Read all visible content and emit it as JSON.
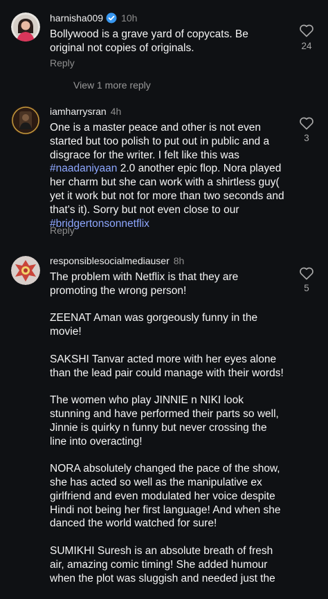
{
  "comments": [
    {
      "username": "harnisha009",
      "time": "10h",
      "verified": true,
      "text": "Bollywood is a grave yard of copycats. Be original not copies of originals.",
      "reply_label": "Reply",
      "view_more_label": "View 1 more reply",
      "likes": "24"
    },
    {
      "username": "iamharrysran",
      "time": "4h",
      "text_before_tag1": "One is a master peace and other is not even started but too polish to put out in public and a disgrace for the writer. I felt like this was ",
      "tag1": "#naadaniyaan",
      "text_between": " 2.0 another epic flop. Nora played her charm but she can work with a shirtless guy( yet it work but not for more than two seconds and that's it). Sorry but not even close to our ",
      "tag2": "#bridgertonsonnetflix",
      "reply_label": "Reply",
      "likes": "3"
    },
    {
      "username": "responsiblesocialmediauser",
      "time": "8h",
      "paragraphs": [
        "The problem with Netflix is that they are promoting the wrong person!",
        "ZEENAT Aman was gorgeously funny in the movie!",
        "SAKSHI Tanvar acted more with her eyes alone than the lead pair could manage with their words!",
        "The women who play JINNIE n NIKI look stunning and have performed their parts so well, Jinnie is quirky n funny but never crossing the line into overacting!",
        "NORA absolutely changed the pace of the show, she has acted so well as the manipulative ex girlfriend and even modulated her voice despite Hindi not being her first language! And when she danced the world watched for sure!",
        "SUMIKHI Suresh is an absolute breath of fresh air, amazing comic timing! She added humour when the plot was sluggish and needed just the"
      ],
      "likes": "5"
    }
  ],
  "icons": {
    "like": "heart-outline-icon",
    "verified": "verified-badge-icon"
  },
  "colors": {
    "background": "#0f1114",
    "hashtag": "#8ea7ff",
    "muted": "#8e8e8e",
    "verified": "#3897f0"
  }
}
